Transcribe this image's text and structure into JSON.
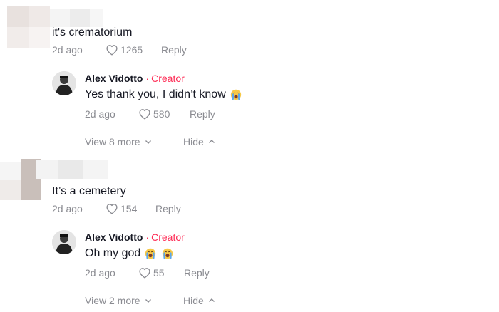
{
  "colors": {
    "text": "#161823",
    "muted": "#8a8b91",
    "creator": "#fe2c55"
  },
  "threads": [
    {
      "comment": {
        "text": "it's crematorium",
        "date": "2d ago",
        "likes": "1265",
        "reply_label": "Reply"
      },
      "reply": {
        "name": "Alex Vidotto",
        "separator": "·",
        "badge": "Creator",
        "text": "Yes thank you, I didn’t know",
        "emojis": [
          "crying-face-emoji"
        ],
        "date": "2d ago",
        "likes": "580",
        "reply_label": "Reply"
      },
      "view_more": "View 8 more",
      "hide": "Hide"
    },
    {
      "comment": {
        "text": "It’s a cemetery",
        "date": "2d ago",
        "likes": "154",
        "reply_label": "Reply"
      },
      "reply": {
        "name": "Alex Vidotto",
        "separator": "·",
        "badge": "Creator",
        "text": "Oh my god",
        "emojis": [
          "crying-face-emoji",
          "crying-face-emoji"
        ],
        "date": "2d ago",
        "likes": "55",
        "reply_label": "Reply"
      },
      "view_more": "View 2 more",
      "hide": "Hide"
    }
  ]
}
